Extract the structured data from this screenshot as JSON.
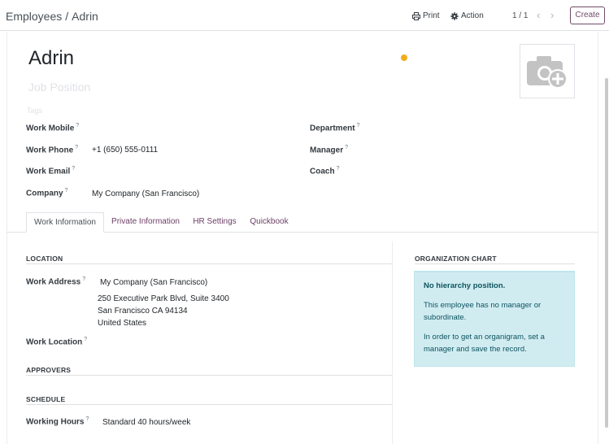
{
  "breadcrumb": {
    "parent": "Employees",
    "separator": "/",
    "current": "Adrin"
  },
  "toolbar": {
    "print_label": "Print",
    "action_label": "Action",
    "pager": "1 / 1",
    "create_label": "Create"
  },
  "employee": {
    "name": "Adrin",
    "job_position_placeholder": "Job Position",
    "tags_placeholder": "Tags"
  },
  "fields": {
    "work_mobile": {
      "label": "Work Mobile",
      "hint": "?",
      "value": ""
    },
    "work_phone": {
      "label": "Work Phone",
      "hint": "?",
      "value": "+1 (650) 555-0111"
    },
    "work_email": {
      "label": "Work Email",
      "hint": "?",
      "value": ""
    },
    "company": {
      "label": "Company",
      "hint": "?",
      "value": "My Company (San Francisco)"
    },
    "department": {
      "label": "Department",
      "hint": "?",
      "value": ""
    },
    "manager": {
      "label": "Manager",
      "hint": "?",
      "value": ""
    },
    "coach": {
      "label": "Coach",
      "hint": "?",
      "value": ""
    }
  },
  "tabs": [
    "Work Information",
    "Private Information",
    "HR Settings",
    "Quickbook"
  ],
  "work_info": {
    "location_title": "LOCATION",
    "work_address_label": "Work Address",
    "work_address_hint": "?",
    "work_address_name": "My Company (San Francisco)",
    "address_line1": "250 Executive Park Blvd, Suite 3400",
    "address_line2": "San Francisco CA 94134",
    "address_line3": "United States",
    "work_location_label": "Work Location",
    "work_location_hint": "?",
    "approvers_title": "APPROVERS",
    "schedule_title": "SCHEDULE",
    "working_hours_label": "Working Hours",
    "working_hours_hint": "?",
    "working_hours_value": "Standard 40 hours/week"
  },
  "org_chart": {
    "title": "ORGANIZATION CHART",
    "heading": "No hierarchy position.",
    "line1": "This employee has no manager or subordinate.",
    "line2": "In order to get an organigram, set a manager and save the record."
  },
  "colors": {
    "accent": "#714b67",
    "status_dot": "#f0ad1e",
    "info_bg": "#d1ecf1",
    "info_text": "#0c5460"
  }
}
